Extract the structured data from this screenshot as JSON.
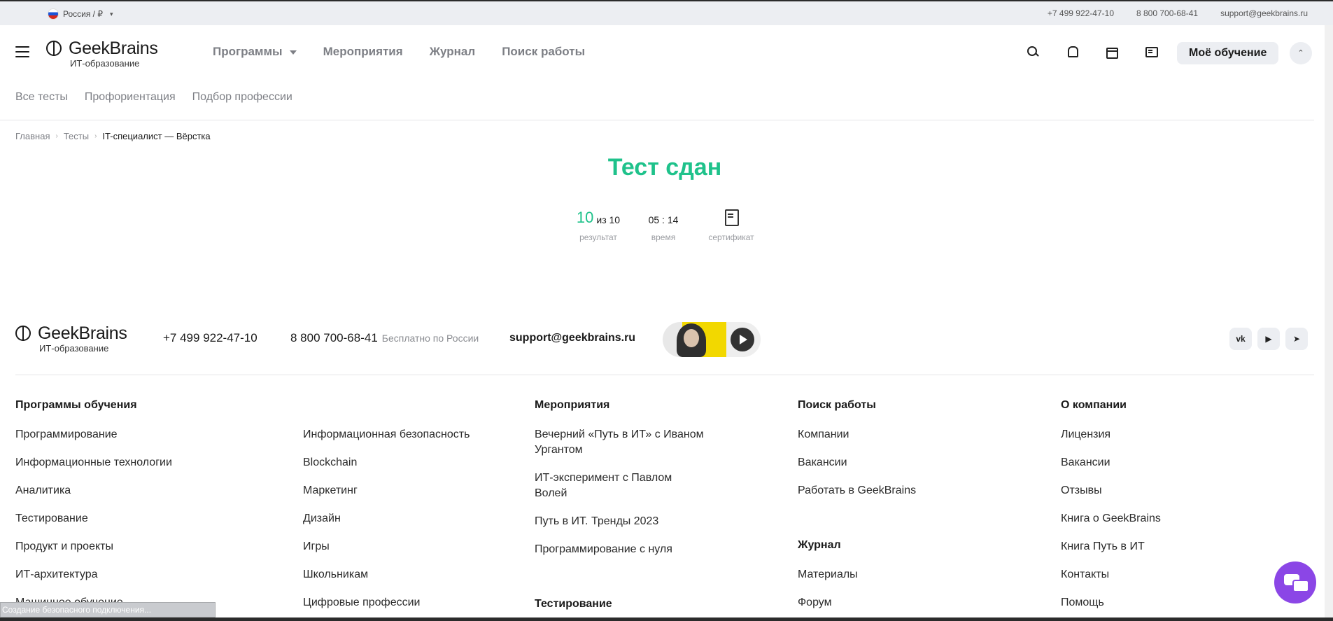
{
  "topbar": {
    "region": "Россия / ₽",
    "phone1": "+7 499 922-47-10",
    "phone2": "8 800 700-68-41",
    "email": "support@geekbrains.ru"
  },
  "header": {
    "logo_name": "GeekBrains",
    "logo_sub": "ИТ-образование",
    "nav": [
      "Программы",
      "Мероприятия",
      "Журнал",
      "Поиск работы"
    ],
    "my_learning": "Моё обучение",
    "icons": [
      "search-icon",
      "bell-icon",
      "calendar-icon",
      "chat-icon",
      "user-icon"
    ]
  },
  "subnav": [
    "Все тесты",
    "Профориентация",
    "Подбор профессии"
  ],
  "breadcrumb": {
    "items": [
      "Главная",
      "Тесты"
    ],
    "current": "IT-специалист — Вёрстка"
  },
  "result": {
    "title": "Тест сдан",
    "score": "10",
    "score_total": "из 10",
    "score_label": "результат",
    "time": "05 : 14",
    "time_label": "время",
    "cert_label": "сертификат"
  },
  "footer": {
    "logo_name": "GeekBrains",
    "logo_sub": "ИТ-образование",
    "phone1": "+7 499 922-47-10",
    "phone2": "8 800 700-68-41",
    "phone2_note": "Бесплатно по России",
    "email": "support@geekbrains.ru",
    "socials": [
      "vk-icon",
      "youtube-icon",
      "telegram-icon"
    ],
    "programs": {
      "title": "Программы обучения",
      "col1": [
        "Программирование",
        "Информационные технологии",
        "Аналитика",
        "Тестирование",
        "Продукт и проекты",
        "ИТ-архитектура",
        "Машинное обучение"
      ],
      "col2": [
        "Информационная безопасность",
        "Blockchain",
        "Маркетинг",
        "Дизайн",
        "Игры",
        "Школьникам",
        "Цифровые профессии"
      ]
    },
    "events": {
      "title": "Мероприятия",
      "items": [
        "Вечерний «Путь в ИТ» с Иваном",
        "Ургантом",
        "ИТ-эксперимент с Павлом",
        "Волей",
        "Путь в ИТ. Тренды 2023",
        "Программирование с нуля"
      ],
      "testing_title": "Тестирование"
    },
    "jobs": {
      "title": "Поиск работы",
      "items": [
        "Компании",
        "Вакансии",
        "Работать в GeekBrains"
      ],
      "journal_title": "Журнал",
      "journal_items": [
        "Материалы",
        "Форум"
      ]
    },
    "company": {
      "title": "О компании",
      "items": [
        "Лицензия",
        "Вакансии",
        "Отзывы",
        "Книга о GeekBrains",
        "Книга Путь в ИТ",
        "Контакты",
        "Помощь"
      ]
    }
  },
  "status_text": "Создание безопасного подключения..."
}
